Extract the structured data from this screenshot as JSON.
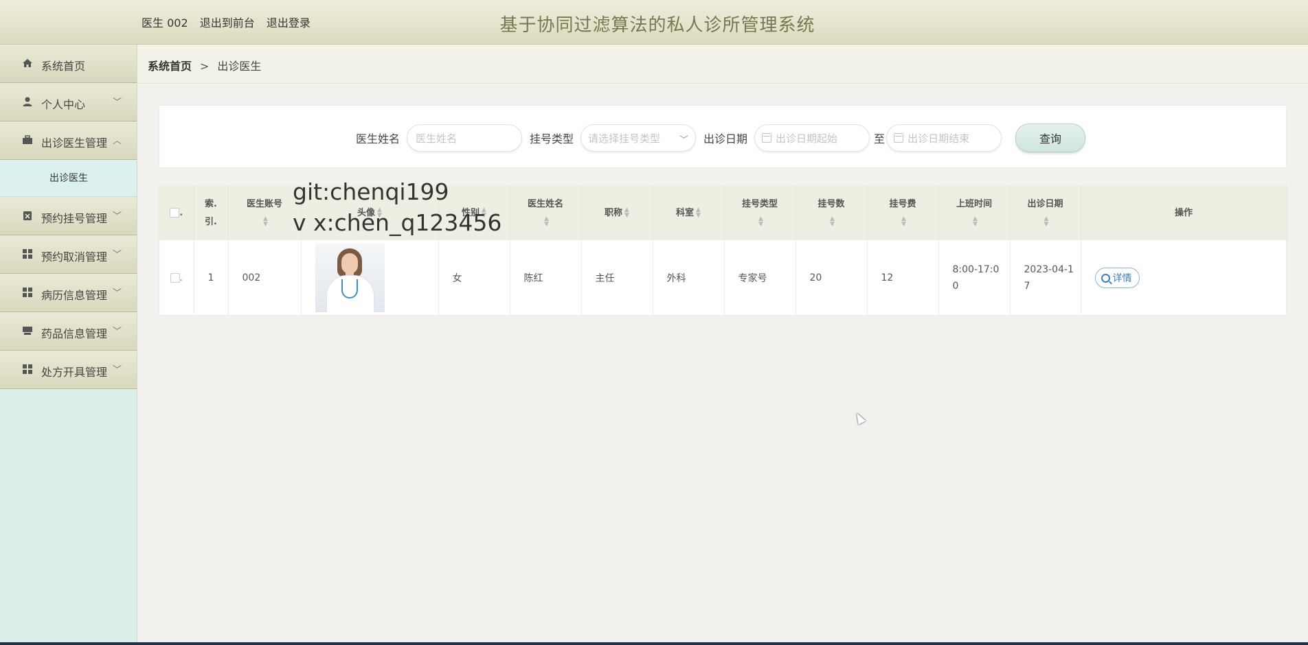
{
  "header": {
    "user": "医生 002",
    "to_front": "退出到前台",
    "logout": "退出登录",
    "title": "基于协同过滤算法的私人诊所管理系统"
  },
  "sidebar": {
    "items": [
      {
        "label": "系统首页",
        "icon": "home-icon"
      },
      {
        "label": "个人中心",
        "icon": "user-icon",
        "chevron": "﹀"
      },
      {
        "label": "出诊医生管理",
        "icon": "briefcase-icon",
        "chevron": "︿"
      },
      {
        "label": "预约挂号管理",
        "icon": "clipboard-icon",
        "chevron": "﹀"
      },
      {
        "label": "预约取消管理",
        "icon": "grid-icon",
        "chevron": "﹀"
      },
      {
        "label": "病历信息管理",
        "icon": "grid-icon",
        "chevron": "﹀"
      },
      {
        "label": "药品信息管理",
        "icon": "box-icon",
        "chevron": "﹀"
      },
      {
        "label": "处方开具管理",
        "icon": "grid-icon",
        "chevron": "﹀"
      }
    ],
    "submenu": "出诊医生"
  },
  "breadcrumb": {
    "home": "系统首页",
    "sep": ">",
    "current": "出诊医生"
  },
  "search": {
    "doctor_label": "医生姓名",
    "doctor_placeholder": "医生姓名",
    "type_label": "挂号类型",
    "type_placeholder": "请选择挂号类型",
    "date_label": "出诊日期",
    "date_start_placeholder": "出诊日期起始",
    "to": "至",
    "date_end_placeholder": "出诊日期结束",
    "query": "查询"
  },
  "table": {
    "headers": {
      "index_1": "索.",
      "index_2": "引.",
      "account": "医生账号",
      "avatar": "头像",
      "gender": "性别",
      "name": "医生姓名",
      "title": "职称",
      "dept": "科室",
      "reg_type": "挂号类型",
      "reg_count": "挂号数",
      "reg_fee": "挂号费",
      "work_time": "上班时间",
      "date": "出诊日期",
      "ops": "操作"
    },
    "rows": [
      {
        "index": "1",
        "account": "002",
        "gender": "女",
        "name": "陈红",
        "title": "主任",
        "dept": "外科",
        "reg_type": "专家号",
        "reg_count": "20",
        "reg_fee": "12",
        "work_time": "8:00-17:00",
        "date": "2023-04-17",
        "detail": "详情"
      }
    ]
  },
  "watermark": {
    "line1": "git:chenqi199",
    "line2": "v x:chen_q123456"
  }
}
